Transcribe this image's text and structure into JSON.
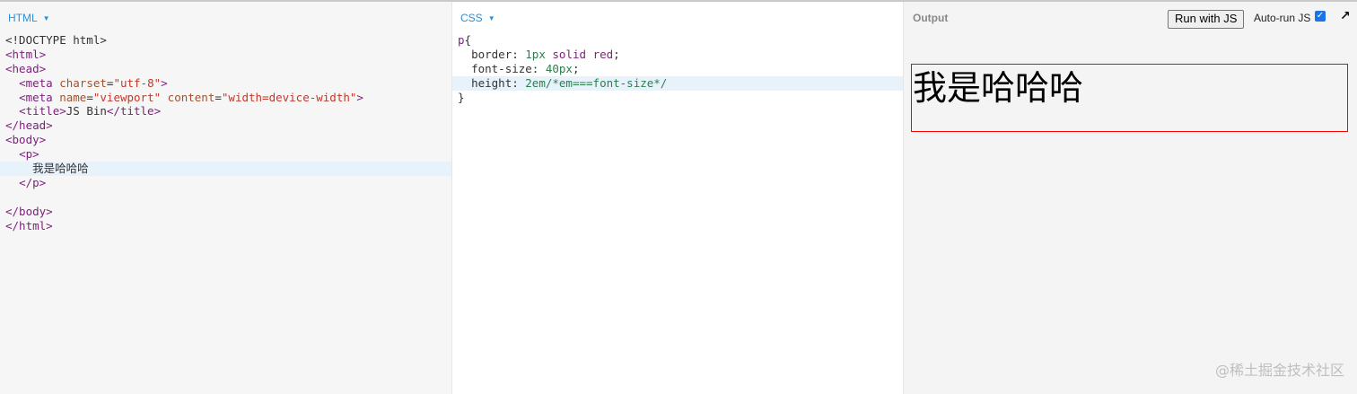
{
  "panels": {
    "html": {
      "title": "HTML"
    },
    "css": {
      "title": "CSS"
    },
    "output": {
      "title": "Output",
      "run_label": "Run with JS",
      "autorun_label": "Auto-run JS",
      "autorun_checked": true
    }
  },
  "html_code": {
    "l1": "<!DOCTYPE html>",
    "l2": "<html>",
    "l3": "<head>",
    "l4_tag_open": "<meta",
    "l4_attr": "charset",
    "l4_eq": "=",
    "l4_str": "\"utf-8\"",
    "l4_close": ">",
    "l5_tag_open": "<meta",
    "l5_attr1": "name",
    "l5_str1": "\"viewport\"",
    "l5_attr2": "content",
    "l5_str2": "\"width=device-width\"",
    "l5_close": ">",
    "l6_open": "<title>",
    "l6_text": "JS Bin",
    "l6_close": "</title>",
    "l7": "</head>",
    "l8": "<body>",
    "l9": "<p>",
    "l10": "我是哈哈哈",
    "l11": "</p>",
    "l13": "</body>",
    "l14": "</html>"
  },
  "css_code": {
    "sel": "p",
    "open_brace": "{",
    "l2_prop": "border:",
    "l2_num": "1px",
    "l2_kw1": "solid",
    "l2_kw2": "red",
    "l3_prop": "font-size:",
    "l3_num": "40px",
    "l4_prop": "height:",
    "l4_num": "2em",
    "l4_cmt": "/*em===font-size*/",
    "semi": ";",
    "close_brace": "}"
  },
  "output_content": {
    "text": "我是哈哈哈"
  },
  "watermark": "@稀土掘金技术社区",
  "colors": {
    "accent": "#2b8fd8",
    "border_red": "#ff0000",
    "active_line": "#e8f2fb"
  },
  "icons": {
    "caret": "chevron-down-icon",
    "expand": "expand-arrow-icon",
    "checkbox": "checkbox-checked-icon"
  }
}
